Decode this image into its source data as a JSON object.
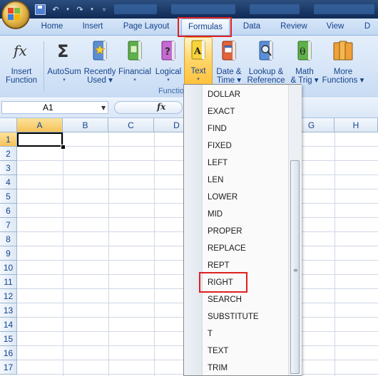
{
  "ribbon_tabs": [
    "Home",
    "Insert",
    "Page Layout",
    "Formulas",
    "Data",
    "Review",
    "View"
  ],
  "active_tab": "Formulas",
  "ribbon_buttons": [
    {
      "line1": "Insert",
      "line2": "Function",
      "icon": "fx-icon"
    },
    {
      "line1": "AutoSum",
      "line2": "▾",
      "icon": "sigma-icon"
    },
    {
      "line1": "Recently",
      "line2": "Used ▾",
      "icon": "star-book-icon"
    },
    {
      "line1": "Financial",
      "line2": "▾",
      "icon": "financial-book-icon"
    },
    {
      "line1": "Logical",
      "line2": "▾",
      "icon": "question-book-icon"
    },
    {
      "line1": "Text",
      "line2": "▾",
      "icon": "text-book-icon"
    },
    {
      "line1": "Date &",
      "line2": "Time ▾",
      "icon": "calendar-book-icon"
    },
    {
      "line1": "Lookup &",
      "line2": "Reference ▾",
      "icon": "magnifier-book-icon"
    },
    {
      "line1": "Math",
      "line2": "& Trig ▾",
      "icon": "theta-book-icon"
    },
    {
      "line1": "More",
      "line2": "Functions ▾",
      "icon": "more-books-icon"
    }
  ],
  "group_label": "Functio",
  "formula_bar": {
    "name_box": "A1",
    "fx": "fx"
  },
  "columns": [
    "A",
    "B",
    "C",
    "D",
    "G",
    "H"
  ],
  "rows": [
    "1",
    "2",
    "3",
    "4",
    "5",
    "6",
    "7",
    "8",
    "9",
    "10",
    "11",
    "12",
    "13",
    "14",
    "15",
    "16",
    "17"
  ],
  "active_cell": "A1",
  "text_functions": [
    "DOLLAR",
    "EXACT",
    "FIND",
    "FIXED",
    "LEFT",
    "LEN",
    "LOWER",
    "MID",
    "PROPER",
    "REPLACE",
    "REPT",
    "RIGHT",
    "SEARCH",
    "SUBSTITUTE",
    "T",
    "TEXT",
    "TRIM"
  ],
  "highlighted_function": "RIGHT",
  "colors": {
    "highlight_box": "#e02020",
    "ribbon_bg": "#d6e5f7",
    "active_button": "#ffd66b"
  }
}
